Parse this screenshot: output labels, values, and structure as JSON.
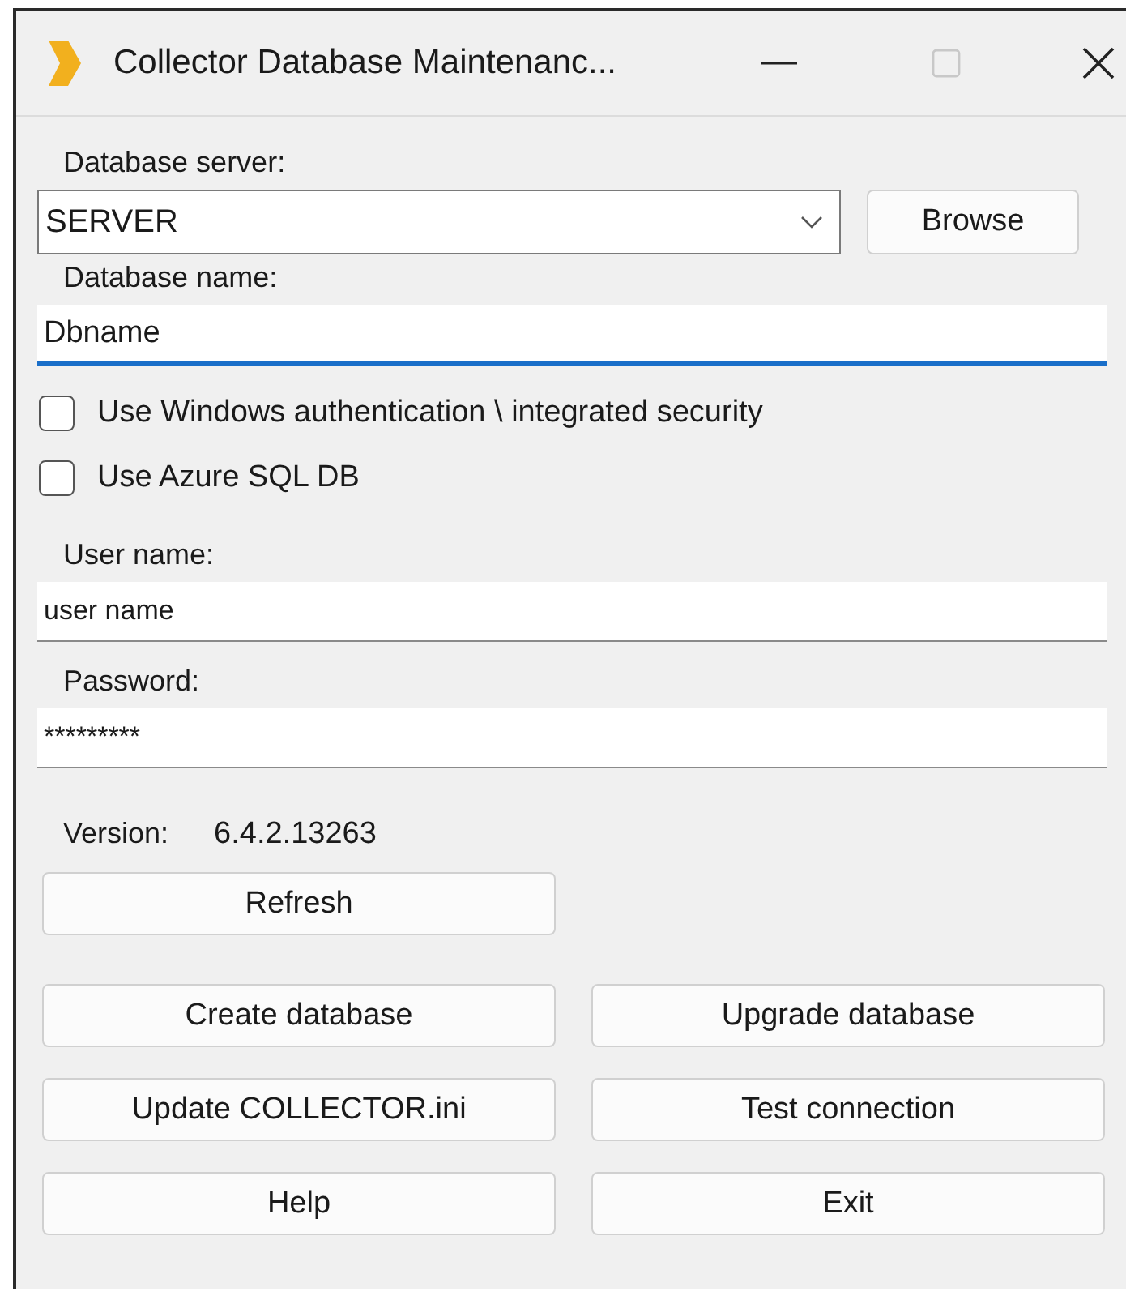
{
  "window": {
    "title": "Collector Database Maintenanc..."
  },
  "server": {
    "label": "Database server:",
    "value": "SERVER",
    "browse": "Browse"
  },
  "database": {
    "label": "Database name:",
    "value": "Dbname",
    "focused": true
  },
  "options": [
    {
      "label": "Use Windows authentication \\ integrated security",
      "checked": false
    },
    {
      "label": "Use Azure SQL DB",
      "checked": false
    }
  ],
  "user": {
    "label": "User name:",
    "value": "user name",
    "focused": false
  },
  "password": {
    "label": "Password:",
    "value": "*********",
    "focused": false
  },
  "version": {
    "label": "Version:",
    "value": "6.4.2.13263"
  },
  "refresh": "Refresh",
  "buttons": [
    "Create database",
    "Upgrade database",
    "Update COLLECTOR.ini",
    "Test connection",
    "Help",
    "Exit"
  ]
}
